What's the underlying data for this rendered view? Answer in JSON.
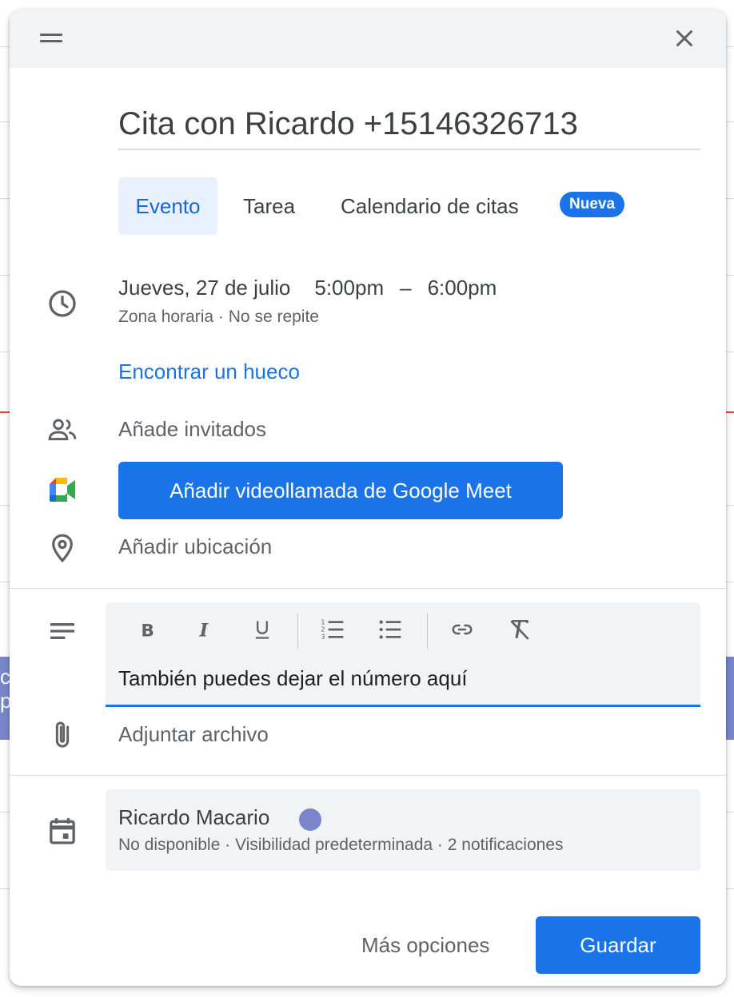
{
  "event": {
    "title": "Cita con Ricardo +15146326713"
  },
  "tabs": [
    {
      "label": "Evento",
      "active": true
    },
    {
      "label": "Tarea",
      "active": false
    },
    {
      "label": "Calendario de citas",
      "active": false
    }
  ],
  "badge_new": "Nueva",
  "time": {
    "date": "Jueves, 27 de julio",
    "start": "5:00pm",
    "separator": "–",
    "end": "6:00pm",
    "timezone": "Zona horaria",
    "dot": "·",
    "repeat": "No se repite"
  },
  "find_slot_link": "Encontrar un hueco",
  "guests_placeholder": "Añade invitados",
  "meet_button": "Añadir videollamada de Google Meet",
  "location_placeholder": "Añadir ubicación",
  "description": {
    "text": "También puedes dejar el número aquí"
  },
  "attach_label": "Adjuntar archivo",
  "calendar": {
    "name": "Ricardo Macario",
    "color": "#7986cb",
    "status": "No disponible",
    "visibility": "Visibilidad predeterminada",
    "notifications": "2 notificaciones",
    "dot": "·"
  },
  "footer": {
    "more_options": "Más opciones",
    "save": "Guardar"
  },
  "colors": {
    "accent": "#1a73e8",
    "header_bg": "#f1f3f4"
  },
  "background_event_fragments": {
    "left_line1": "c",
    "left_line2": "p"
  }
}
